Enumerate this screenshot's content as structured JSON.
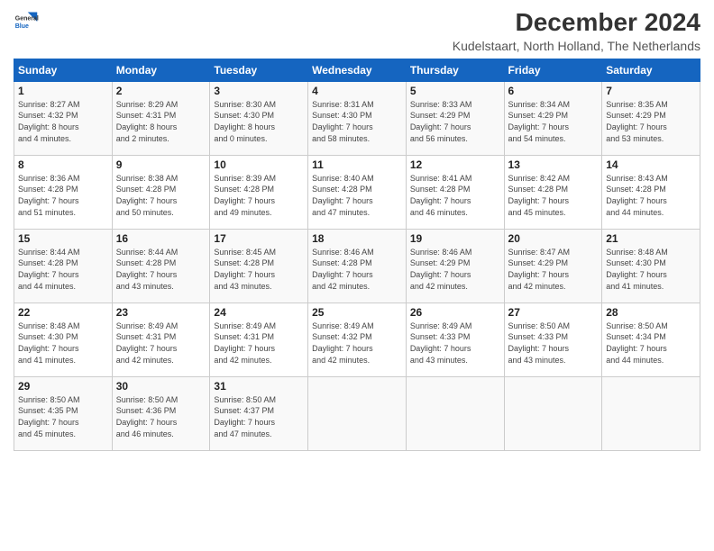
{
  "logo": {
    "line1": "General",
    "line2": "Blue"
  },
  "title": "December 2024",
  "subtitle": "Kudelstaart, North Holland, The Netherlands",
  "days_header": [
    "Sunday",
    "Monday",
    "Tuesday",
    "Wednesday",
    "Thursday",
    "Friday",
    "Saturday"
  ],
  "weeks": [
    [
      {
        "day": "1",
        "info": "Sunrise: 8:27 AM\nSunset: 4:32 PM\nDaylight: 8 hours\nand 4 minutes."
      },
      {
        "day": "2",
        "info": "Sunrise: 8:29 AM\nSunset: 4:31 PM\nDaylight: 8 hours\nand 2 minutes."
      },
      {
        "day": "3",
        "info": "Sunrise: 8:30 AM\nSunset: 4:30 PM\nDaylight: 8 hours\nand 0 minutes."
      },
      {
        "day": "4",
        "info": "Sunrise: 8:31 AM\nSunset: 4:30 PM\nDaylight: 7 hours\nand 58 minutes."
      },
      {
        "day": "5",
        "info": "Sunrise: 8:33 AM\nSunset: 4:29 PM\nDaylight: 7 hours\nand 56 minutes."
      },
      {
        "day": "6",
        "info": "Sunrise: 8:34 AM\nSunset: 4:29 PM\nDaylight: 7 hours\nand 54 minutes."
      },
      {
        "day": "7",
        "info": "Sunrise: 8:35 AM\nSunset: 4:29 PM\nDaylight: 7 hours\nand 53 minutes."
      }
    ],
    [
      {
        "day": "8",
        "info": "Sunrise: 8:36 AM\nSunset: 4:28 PM\nDaylight: 7 hours\nand 51 minutes."
      },
      {
        "day": "9",
        "info": "Sunrise: 8:38 AM\nSunset: 4:28 PM\nDaylight: 7 hours\nand 50 minutes."
      },
      {
        "day": "10",
        "info": "Sunrise: 8:39 AM\nSunset: 4:28 PM\nDaylight: 7 hours\nand 49 minutes."
      },
      {
        "day": "11",
        "info": "Sunrise: 8:40 AM\nSunset: 4:28 PM\nDaylight: 7 hours\nand 47 minutes."
      },
      {
        "day": "12",
        "info": "Sunrise: 8:41 AM\nSunset: 4:28 PM\nDaylight: 7 hours\nand 46 minutes."
      },
      {
        "day": "13",
        "info": "Sunrise: 8:42 AM\nSunset: 4:28 PM\nDaylight: 7 hours\nand 45 minutes."
      },
      {
        "day": "14",
        "info": "Sunrise: 8:43 AM\nSunset: 4:28 PM\nDaylight: 7 hours\nand 44 minutes."
      }
    ],
    [
      {
        "day": "15",
        "info": "Sunrise: 8:44 AM\nSunset: 4:28 PM\nDaylight: 7 hours\nand 44 minutes."
      },
      {
        "day": "16",
        "info": "Sunrise: 8:44 AM\nSunset: 4:28 PM\nDaylight: 7 hours\nand 43 minutes."
      },
      {
        "day": "17",
        "info": "Sunrise: 8:45 AM\nSunset: 4:28 PM\nDaylight: 7 hours\nand 43 minutes."
      },
      {
        "day": "18",
        "info": "Sunrise: 8:46 AM\nSunset: 4:28 PM\nDaylight: 7 hours\nand 42 minutes."
      },
      {
        "day": "19",
        "info": "Sunrise: 8:46 AM\nSunset: 4:29 PM\nDaylight: 7 hours\nand 42 minutes."
      },
      {
        "day": "20",
        "info": "Sunrise: 8:47 AM\nSunset: 4:29 PM\nDaylight: 7 hours\nand 42 minutes."
      },
      {
        "day": "21",
        "info": "Sunrise: 8:48 AM\nSunset: 4:30 PM\nDaylight: 7 hours\nand 41 minutes."
      }
    ],
    [
      {
        "day": "22",
        "info": "Sunrise: 8:48 AM\nSunset: 4:30 PM\nDaylight: 7 hours\nand 41 minutes."
      },
      {
        "day": "23",
        "info": "Sunrise: 8:49 AM\nSunset: 4:31 PM\nDaylight: 7 hours\nand 42 minutes."
      },
      {
        "day": "24",
        "info": "Sunrise: 8:49 AM\nSunset: 4:31 PM\nDaylight: 7 hours\nand 42 minutes."
      },
      {
        "day": "25",
        "info": "Sunrise: 8:49 AM\nSunset: 4:32 PM\nDaylight: 7 hours\nand 42 minutes."
      },
      {
        "day": "26",
        "info": "Sunrise: 8:49 AM\nSunset: 4:33 PM\nDaylight: 7 hours\nand 43 minutes."
      },
      {
        "day": "27",
        "info": "Sunrise: 8:50 AM\nSunset: 4:33 PM\nDaylight: 7 hours\nand 43 minutes."
      },
      {
        "day": "28",
        "info": "Sunrise: 8:50 AM\nSunset: 4:34 PM\nDaylight: 7 hours\nand 44 minutes."
      }
    ],
    [
      {
        "day": "29",
        "info": "Sunrise: 8:50 AM\nSunset: 4:35 PM\nDaylight: 7 hours\nand 45 minutes."
      },
      {
        "day": "30",
        "info": "Sunrise: 8:50 AM\nSunset: 4:36 PM\nDaylight: 7 hours\nand 46 minutes."
      },
      {
        "day": "31",
        "info": "Sunrise: 8:50 AM\nSunset: 4:37 PM\nDaylight: 7 hours\nand 47 minutes."
      },
      {
        "day": "",
        "info": ""
      },
      {
        "day": "",
        "info": ""
      },
      {
        "day": "",
        "info": ""
      },
      {
        "day": "",
        "info": ""
      }
    ]
  ]
}
